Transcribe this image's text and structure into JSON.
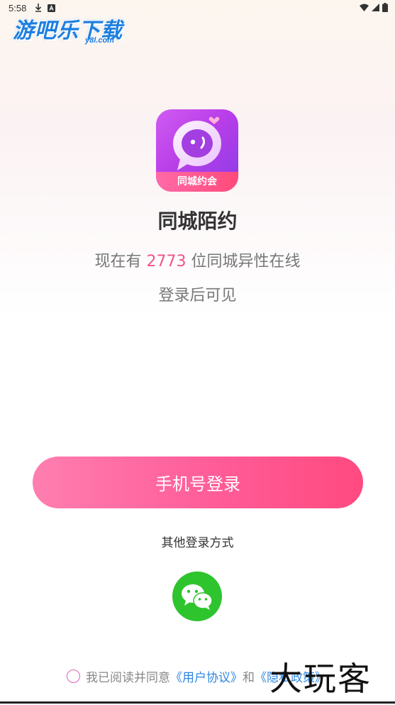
{
  "status_bar": {
    "time": "5:58"
  },
  "watermark_top": {
    "title": "游吧乐下载",
    "subtitle": "y8l.com"
  },
  "app": {
    "icon_label": "同城约会",
    "name": "同城陌约"
  },
  "online": {
    "prefix": "现在有",
    "count": "2773",
    "suffix": "位同城异性在线"
  },
  "login_hint": "登录后可见",
  "phone_login_label": "手机号登录",
  "other_login_label": "其他登录方式",
  "agreement": {
    "text": "我已阅读并同意",
    "user_agreement": "《用户协议》",
    "and": "和",
    "privacy_policy": "《隐私政策》"
  },
  "watermark_bottom": "大玩客",
  "colors": {
    "accent_pink": "#ff5c98",
    "count_pink": "#f0538d",
    "wechat_green": "#2ec42e",
    "link_blue": "#2f86e0"
  }
}
